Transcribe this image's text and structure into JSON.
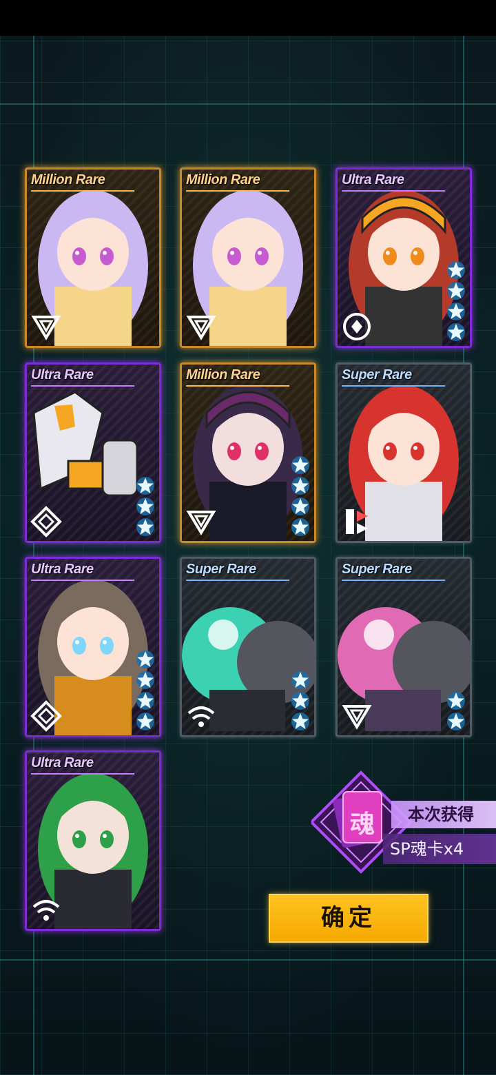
{
  "cards": [
    {
      "rarity": "Million Rare",
      "tier": "million",
      "stars": 0,
      "faction": "triangle-emblem-icon"
    },
    {
      "rarity": "Million Rare",
      "tier": "million",
      "stars": 0,
      "faction": "triangle-emblem-icon"
    },
    {
      "rarity": "Ultra Rare",
      "tier": "ultra",
      "stars": 4,
      "faction": "circle-emblem-icon"
    },
    {
      "rarity": "Ultra Rare",
      "tier": "ultra",
      "stars": 3,
      "faction": "diamond-emblem-icon"
    },
    {
      "rarity": "Million Rare",
      "tier": "million",
      "stars": 4,
      "faction": "triangle-emblem-icon"
    },
    {
      "rarity": "Super Rare",
      "tier": "super",
      "stars": 0,
      "faction": "stripes-emblem-icon"
    },
    {
      "rarity": "Ultra Rare",
      "tier": "ultra",
      "stars": 4,
      "faction": "diamond-emblem-icon"
    },
    {
      "rarity": "Super Rare",
      "tier": "super",
      "stars": 3,
      "faction": "wifi-emblem-icon"
    },
    {
      "rarity": "Super Rare",
      "tier": "super",
      "stars": 2,
      "faction": "triangle-emblem-icon"
    },
    {
      "rarity": "Ultra Rare",
      "tier": "ultra",
      "stars": 0,
      "faction": "wifi-emblem-icon"
    }
  ],
  "reward": {
    "badge_char": "魂",
    "line1": "本次获得",
    "line2": "SP魂卡x4"
  },
  "confirm_label": "确定",
  "colors": {
    "million_border": "#c9892a",
    "ultra_border": "#7c2bd6",
    "super_border": "#4f5a63",
    "star": "#e8f8ff",
    "button": "#ffc321"
  }
}
